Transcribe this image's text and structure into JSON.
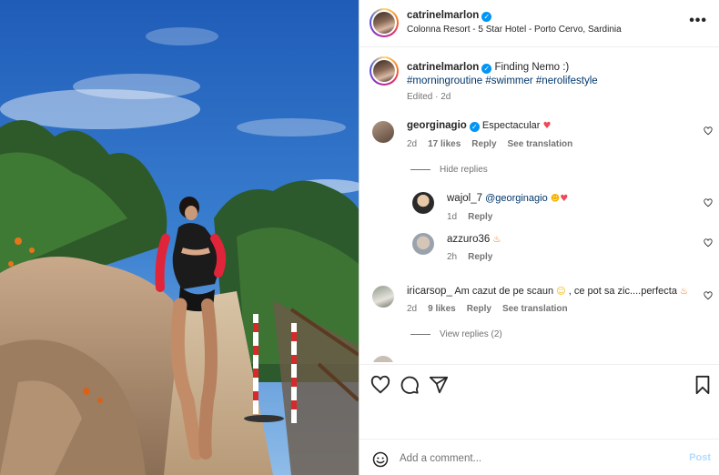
{
  "post": {
    "username": "catrinelmarlon",
    "location": "Colonna Resort - 5 Star Hotel - Porto Cervo, Sardinia",
    "verified_mark": "✓",
    "more_label": "•••"
  },
  "caption": {
    "username": "catrinelmarlon",
    "text": "Finding Nemo :)",
    "hashtags": [
      "#morningroutine",
      "#swimmer",
      "#nerolifestyle"
    ],
    "meta": "Edited · 2d"
  },
  "comments": [
    {
      "username": "georginagio",
      "verified": true,
      "text": "Espectacular",
      "emoji": "heart",
      "time": "2d",
      "likes": "17 likes",
      "reply_label": "Reply",
      "translate_label": "See translation",
      "toggle_replies": "Hide replies",
      "replies": [
        {
          "username": "wajol_7",
          "mention": "@georginagio",
          "emoji": "heart-eyes heart",
          "time": "1d",
          "reply_label": "Reply"
        },
        {
          "username": "azzuro36",
          "emoji": "fire",
          "time": "2h",
          "reply_label": "Reply"
        }
      ]
    },
    {
      "username": "iricarsop_",
      "text_before": "Am cazut de pe scaun",
      "text_after": ", ce pot sa zic....perfecta",
      "emoji": "laughing fire",
      "time": "2d",
      "likes": "9 likes",
      "reply_label": "Reply",
      "translate_label": "See translation",
      "toggle_replies": "View replies (2)"
    }
  ],
  "composer": {
    "placeholder": "Add a comment...",
    "post_label": "Post"
  },
  "icons": {
    "like": "heart-icon",
    "comment": "comment-icon",
    "share": "send-icon",
    "save": "bookmark-icon",
    "emoji": "smiley-icon"
  },
  "colors": {
    "link": "#00376b",
    "verified": "#0095f6",
    "post_disabled": "#b3dbff",
    "secondary_text": "#737373"
  }
}
